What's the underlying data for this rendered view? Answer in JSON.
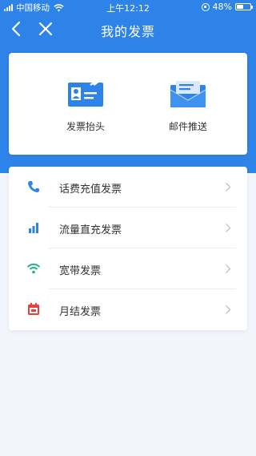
{
  "status_bar": {
    "carrier": "中国移动",
    "time": "上午12:12",
    "battery": "48%",
    "battery_level": 0.48
  },
  "nav": {
    "title": "我的发票",
    "back_icon": "chevron-left-icon",
    "close_icon": "close-icon"
  },
  "shortcuts": [
    {
      "label": "发票抬头",
      "icon": "id-card-icon"
    },
    {
      "label": "邮件推送",
      "icon": "envelope-icon"
    }
  ],
  "list": [
    {
      "label": "话费充值发票",
      "icon": "phone-icon",
      "color": "#2e83e8"
    },
    {
      "label": "流量直充发票",
      "icon": "signal-bars-icon",
      "color": "#2e83e8"
    },
    {
      "label": "宽带发票",
      "icon": "wifi-icon",
      "color": "#1fb27a"
    },
    {
      "label": "月结发票",
      "icon": "calendar-icon",
      "color": "#e8413b"
    }
  ],
  "colors": {
    "brand_blue": "#2e83e8",
    "page_bg": "#f2f5fb"
  }
}
